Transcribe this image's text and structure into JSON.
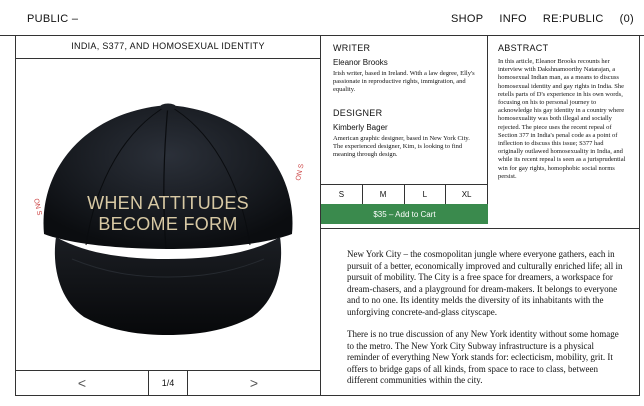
{
  "header": {
    "brand": "PUBLIC –",
    "nav": [
      "SHOP",
      "INFO",
      "RE:PUBLIC",
      "(0)"
    ]
  },
  "product": {
    "title": "INDIA, S377, AND HOMOSEXUAL IDENTITY",
    "cap_text_line1": "WHEN ATTITUDES",
    "cap_text_line2": "BECOME FORM",
    "pager": {
      "prev": "<",
      "count": "1/4",
      "next": ">"
    }
  },
  "writer": {
    "heading": "WRITER",
    "name": "Eleanor Brooks",
    "bio": "Irish writer, based in Ireland. With a law degree, Elly's passionate in reproductive rights, immigration, and equality."
  },
  "designer": {
    "heading": "DESIGNER",
    "name": "Kimberly Bager",
    "bio": "American graphic designer, based in New York City. The experienced designer, Kim, is looking to find meaning through design."
  },
  "sizes": [
    "S",
    "M",
    "L",
    "XL"
  ],
  "cart": {
    "label": "$35 – Add to Cart",
    "color": "#3a8a4d"
  },
  "abstract": {
    "heading": "ABSTRACT",
    "text": "In this article, Eleanor Brooks recounts her interview with Dakshnamoorthy Natarajan, a homosexual Indian man, as a means to discuss homosexual identity and gay rights in India. She retells parts of D's experience in his own words, focusing on his to personal journey to acknowledge his gay identity in a country where homosexuality was both illegal and socially rejected. The piece uses the recent repeal of Section 377 in India's penal code as a point of inflection to discuss this issue; S377 had originally outlawed homosexuality in India, and while its recent repeal is seen as a jurisprudential win for gay rights, homophobic social norms persist."
  },
  "article": {
    "p1": "New York City – the cosmopolitan jungle where everyone gathers, each in pursuit of a better, economically improved and culturally enriched life; all in pursuit of mobility. The City is a free space for dreamers, a workspace for dream-chasers, and a playground for dream-makers. It belongs to everyone and to no one. Its identity melds the diversity of its inhabitants with the unforgiving concrete-and-glass cityscape.",
    "p2": "There is no true discussion of any New York identity without some homage to the metro. The New York City Subway infrastructure is a physical reminder of everything New York stands for: eclecticism, mobility, grit. It offers to bridge gaps of all kinds, from space to race to class, between different communities within the city."
  }
}
